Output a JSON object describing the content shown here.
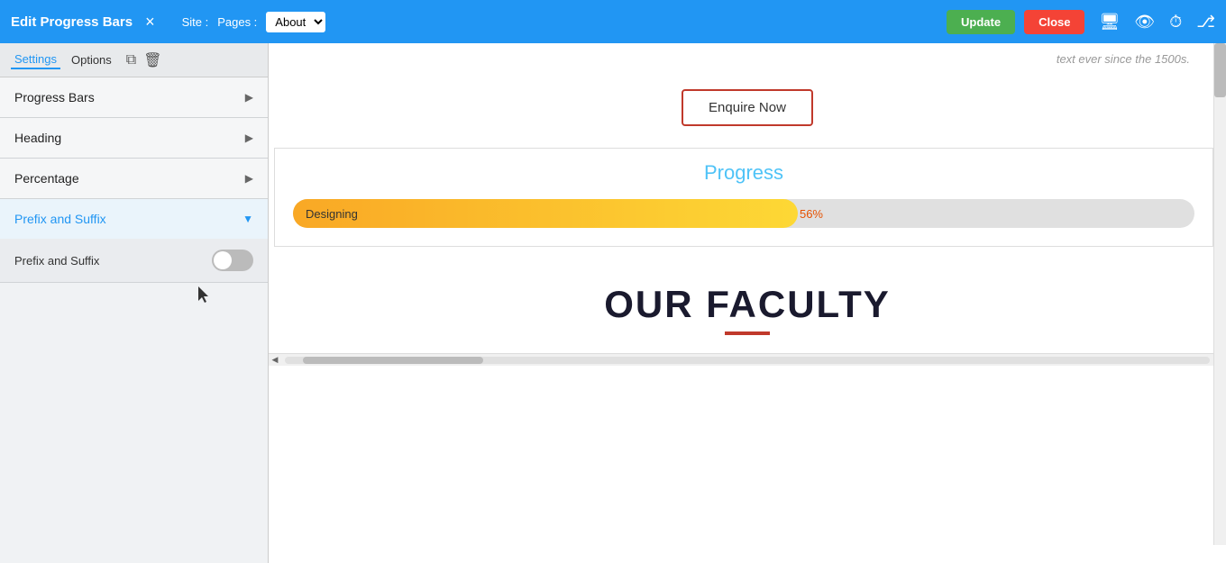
{
  "header": {
    "title": "Edit Progress Bars",
    "close_x": "×",
    "site_label": "Site :",
    "pages_label": "Pages :",
    "page_options": [
      "About"
    ],
    "page_selected": "About",
    "update_btn": "Update",
    "close_btn": "Close",
    "icons": [
      "monitor-icon",
      "eye-icon",
      "history-icon",
      "sitemap-icon"
    ]
  },
  "left_panel": {
    "tabs": [
      {
        "label": "Settings",
        "active": true
      },
      {
        "label": "Options",
        "active": false
      }
    ],
    "duplicate_icon": "⧉",
    "delete_icon": "🗑",
    "accordion": [
      {
        "label": "Progress Bars",
        "expanded": false,
        "active": false
      },
      {
        "label": "Heading",
        "expanded": false,
        "active": false
      },
      {
        "label": "Percentage",
        "expanded": false,
        "active": false
      },
      {
        "label": "Prefix and Suffix",
        "expanded": true,
        "active": true
      }
    ],
    "prefix_suffix": {
      "label": "Prefix and Suffix",
      "toggle_checked": false
    }
  },
  "right_panel": {
    "top_fade_text": "text ever since the 1500s.",
    "enquire_btn": "Enquire Now",
    "progress": {
      "title": "Progress",
      "bars": [
        {
          "label": "Designing",
          "percentage": 56,
          "pct_label": "56%"
        }
      ]
    },
    "faculty": {
      "title": "OUR FACULTY"
    }
  },
  "icons": {
    "monitor": "🖥",
    "eye": "👁",
    "history": "🕐",
    "sitemap": "⎇"
  }
}
